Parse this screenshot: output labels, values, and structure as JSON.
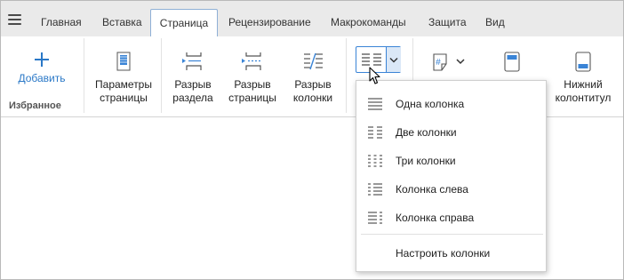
{
  "tabs": [
    "Главная",
    "Вставка",
    "Страница",
    "Рецензирование",
    "Макрокоманды",
    "Защита",
    "Вид"
  ],
  "active_tab": "Страница",
  "favorites": {
    "add_label": "Добавить",
    "group_title": "Избранное"
  },
  "ribbon": {
    "page_settings": "Параметры\nстраницы",
    "section_break": "Разрыв\nраздела",
    "page_break": "Разрыв\nстраницы",
    "column_break": "Разрыв\nколонки",
    "footer": "Нижний\nколонтитул"
  },
  "columns_menu": {
    "items": [
      {
        "label": "Одна колонка",
        "icon": "one-column-icon"
      },
      {
        "label": "Две колонки",
        "icon": "two-columns-icon"
      },
      {
        "label": "Три колонки",
        "icon": "three-columns-icon"
      },
      {
        "label": "Колонка слева",
        "icon": "left-column-icon"
      },
      {
        "label": "Колонка справа",
        "icon": "right-column-icon"
      }
    ],
    "customize_label": "Настроить колонки"
  },
  "colors": {
    "accent": "#2a78c7",
    "tabbar": "#eaeaea"
  }
}
